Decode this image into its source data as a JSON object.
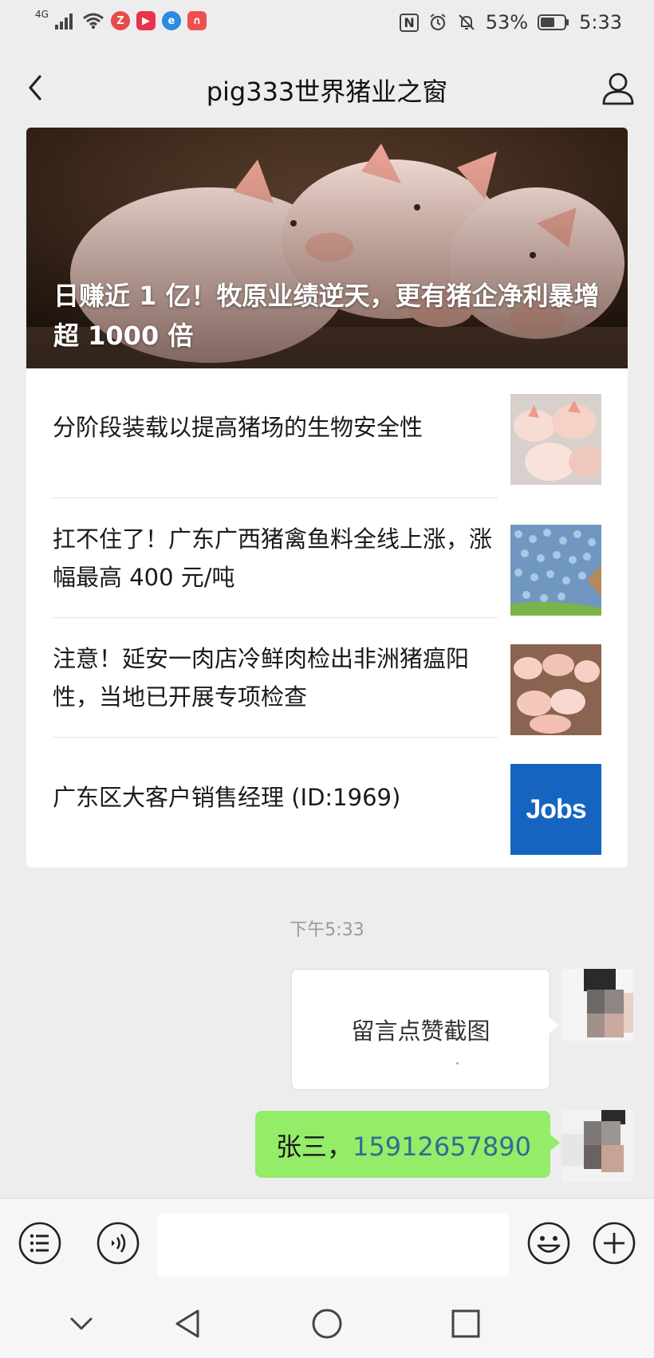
{
  "status_bar": {
    "network": "4G",
    "battery": "53%",
    "time": "5:33",
    "nfc_label": "N"
  },
  "header": {
    "title": "pig333世界猪业之窗"
  },
  "articles": {
    "featured_title": "日赚近 1 亿！牧原业绩逆天，更有猪企净利暴增超 1000 倍",
    "items": [
      {
        "title": "分阶段装载以提高猪场的生物安全性",
        "thumb": "piglets-icon"
      },
      {
        "title": "扛不住了！广东广西猪禽鱼料全线上涨，涨幅最高 400 元/吨",
        "thumb": "feed-pellets-icon"
      },
      {
        "title": "注意！延安一肉店冷鲜肉检出非洲猪瘟阳性，当地已开展专项检查",
        "thumb": "piglets-icon"
      },
      {
        "title": "广东区大客户销售经理 (ID:1969)",
        "thumb": "jobs-logo"
      }
    ],
    "jobs_logo_text": "Jobs"
  },
  "chat": {
    "timestamp": "下午5:33",
    "image_message_text": "留言点赞截图",
    "text_message_name": "张三，",
    "text_message_phone": "15912657890"
  },
  "colors": {
    "chat_background": "#ededed",
    "outgoing_bubble": "#95ec69",
    "jobs_blue": "#1565c0"
  },
  "input_bar": {
    "placeholder": ""
  }
}
